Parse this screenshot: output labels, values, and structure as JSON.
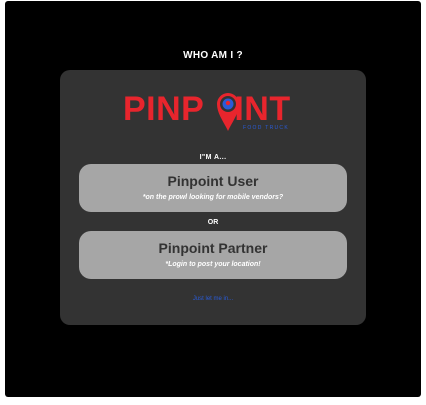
{
  "page": {
    "title": "WHO AM I ?"
  },
  "brand": {
    "logo_left": "PINP",
    "logo_right": "INT",
    "tagline": "FOOD TRUCK",
    "accent_red": "#e8252d",
    "accent_blue": "#2a5bd7"
  },
  "prompt": "I\"M A...",
  "options": [
    {
      "title": "Pinpoint User",
      "subtitle": "*on the prowl looking for mobile vendors?"
    },
    {
      "title": "Pinpoint Partner",
      "subtitle": "*Login to post your location!"
    }
  ],
  "separator": "OR",
  "skip_link": "Just let me in..."
}
